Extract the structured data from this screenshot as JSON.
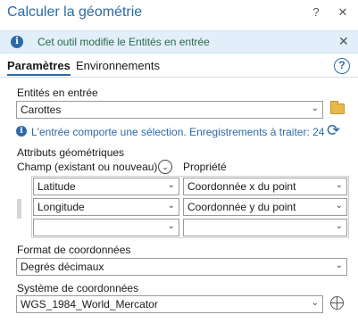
{
  "window": {
    "title": "Calculer la géométrie",
    "help_btn": "?",
    "close_btn": "✕"
  },
  "info_bar": {
    "icon": "i",
    "text": "Cet outil modifie le Entités en entrée",
    "close": "✕"
  },
  "tabs": [
    {
      "label": "Paramètres",
      "active": true
    },
    {
      "label": "Environnements",
      "active": false
    }
  ],
  "help_icon": "?",
  "input_features": {
    "label": "Entités en entrée",
    "value": "Carottes"
  },
  "selection_note": {
    "icon": "i",
    "text": "L'entrée comporte une sélection. Enregistrements à traiter: 24"
  },
  "geometry_attributes": {
    "label": "Attributs géométriques",
    "field_header": "Champ (existant ou nouveau)",
    "property_header": "Propriété",
    "rows": [
      {
        "field": "Latitude",
        "property": "Coordonnée x du point"
      },
      {
        "field": "Longitude",
        "property": "Coordonnée y du point"
      },
      {
        "field": "",
        "property": ""
      }
    ]
  },
  "coordinate_format": {
    "label": "Format de coordonnées",
    "value": "Degrés décimaux"
  },
  "coordinate_system": {
    "label": "Système de coordonnées",
    "value": "WGS_1984_World_Mercator"
  },
  "icons": {
    "dropdown": "chevron-down",
    "folder": "folder-open",
    "refresh": "refresh",
    "globe": "globe",
    "info": "info"
  },
  "colors": {
    "accent": "#2b6aa8",
    "info_bg": "#e2eef9",
    "info_text": "#2b6a4a"
  }
}
